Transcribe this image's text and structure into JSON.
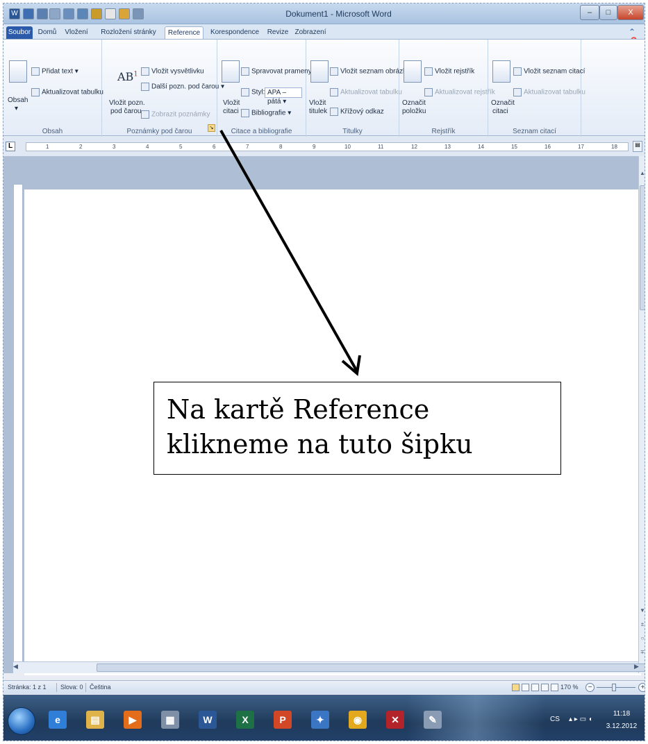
{
  "window": {
    "title": "Dokument1 - Microsoft Word",
    "min_glyph": "–",
    "max_glyph": "□",
    "close_glyph": "X"
  },
  "qat": {
    "word_glyph": "W"
  },
  "tabs": [
    "Soubor",
    "Domů",
    "Vložení",
    "Rozložení stránky",
    "Reference",
    "Korespondence",
    "Revize",
    "Zobrazení"
  ],
  "active_tab": "Reference",
  "ribbon": {
    "toc": {
      "label": "Obsah",
      "add_text": "Přidat text ▾",
      "update_table": "Aktualizovat tabulku",
      "toc_button": "Obsah",
      "toc_arrow": "▾"
    },
    "footnotes": {
      "label": "Poznámky pod čarou",
      "big_icon_text": "AB",
      "big_icon_sup": "1",
      "insert_endnote": "Vložit vysvětlivku",
      "next_footnote": "Další pozn. pod čarou ▾",
      "show_notes": "Zobrazit poznámky",
      "insert_footnote_line1": "Vložit pozn.",
      "insert_footnote_line2": "pod čarou"
    },
    "citations": {
      "label": "Citace a bibliografie",
      "manage_sources": "Spravovat prameny",
      "style_label": "Styl:",
      "style_value": "APA – pátá",
      "bibliography": "Bibliografie ▾",
      "insert_citation_line1": "Vložit",
      "insert_citation_line2": "citaci ▾"
    },
    "captions": {
      "label": "Titulky",
      "insert_table_of_figures": "Vložit seznam obrázků",
      "update_table": "Aktualizovat tabulku",
      "cross_reference": "Křížový odkaz",
      "insert_caption_line1": "Vložit",
      "insert_caption_line2": "titulek"
    },
    "index": {
      "label": "Rejstřík",
      "insert_index": "Vložit rejstřík",
      "update_index": "Aktualizovat rejstřík",
      "mark_entry_line1": "Označit",
      "mark_entry_line2": "položku"
    },
    "authorities": {
      "label": "Seznam citací",
      "insert_table": "Vložit seznam citací",
      "update_table": "Aktualizovat tabulku",
      "mark_citation_line1": "Označit",
      "mark_citation_line2": "citaci"
    },
    "launcher_glyph": "↘"
  },
  "ruler": {
    "tab_selector": "L",
    "numbers": [
      "1",
      "2",
      "3",
      "4",
      "5",
      "6",
      "7",
      "8",
      "9",
      "10",
      "11",
      "12",
      "13",
      "14",
      "15",
      "16",
      "17",
      "18"
    ]
  },
  "scroll": {
    "up": "▲",
    "down": "▼",
    "prev": "±",
    "select": "○",
    "next": "∓",
    "left": "◀",
    "right": "▶"
  },
  "callout": {
    "line1": "Na kartě Reference",
    "line2": "klikneme na tuto šipku"
  },
  "status": {
    "page": "Stránka: 1 z 1",
    "words": "Slova: 0",
    "language": "Čeština",
    "zoom": "170 %",
    "zoom_minus": "−",
    "zoom_plus": "+"
  },
  "taskbar": {
    "apps": [
      {
        "name": "ie",
        "glyph": "e",
        "color": "#2f7fd8"
      },
      {
        "name": "explorer",
        "glyph": "▤",
        "color": "#e0b24a"
      },
      {
        "name": "media-player",
        "glyph": "▶",
        "color": "#e46d1b"
      },
      {
        "name": "calculator",
        "glyph": "▦",
        "color": "#7f8fa6"
      },
      {
        "name": "word",
        "glyph": "W",
        "color": "#2b5797"
      },
      {
        "name": "excel",
        "glyph": "X",
        "color": "#1e7145"
      },
      {
        "name": "powerpoint",
        "glyph": "P",
        "color": "#d24726"
      },
      {
        "name": "network",
        "glyph": "✦",
        "color": "#3a76c4"
      },
      {
        "name": "chrome",
        "glyph": "◉",
        "color": "#e2a91f"
      },
      {
        "name": "acrobat",
        "glyph": "✕",
        "color": "#b3232a"
      },
      {
        "name": "paint",
        "glyph": "✎",
        "color": "#8a9cb3"
      }
    ],
    "lang": "CS",
    "tray": "▴ ▸ ▭ ◖",
    "time": "11:18",
    "date": "3.12.2012"
  }
}
